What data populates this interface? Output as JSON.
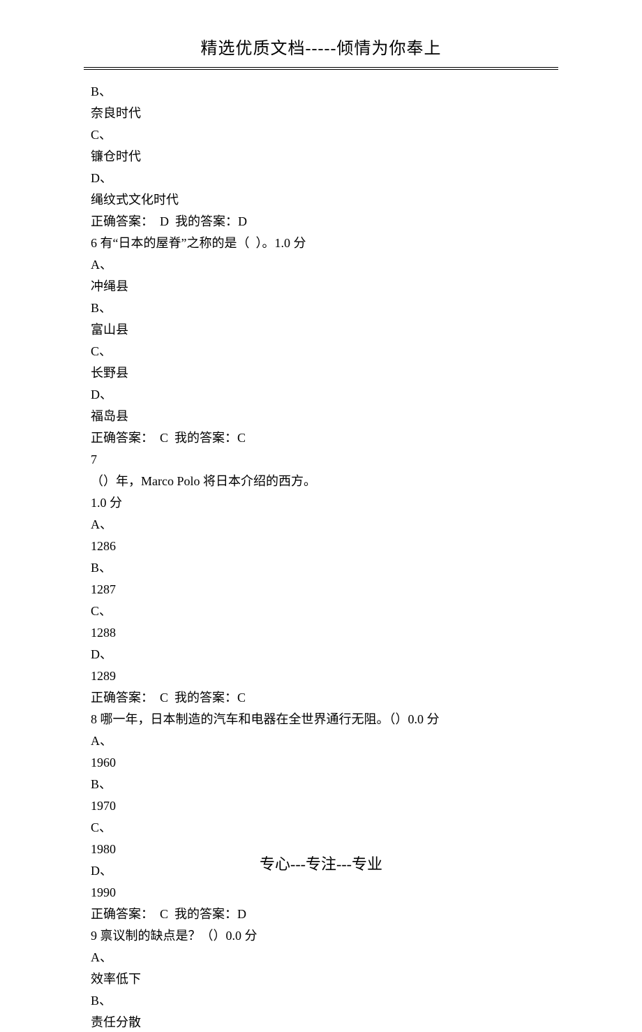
{
  "header": "精选优质文档-----倾情为你奉上",
  "footer": "专心---专注---专业",
  "lines": [
    "B、",
    "奈良时代",
    "C、",
    "镰仓时代",
    "D、",
    "绳纹式文化时代",
    "正确答案：  D  我的答案：D",
    "6 有“日本的屋脊”之称的是（  ）。1.0 分",
    "A、",
    "冲绳县",
    "B、",
    "富山县",
    "C、",
    "长野县",
    "D、",
    "福岛县",
    "正确答案：  C  我的答案：C",
    "7",
    "（）年，Marco Polo 将日本介绍的西方。",
    "1.0 分",
    "A、",
    "1286",
    "B、",
    "1287",
    "C、",
    "1288",
    "D、",
    "1289",
    "正确答案：  C  我的答案：C",
    "8 哪一年，日本制造的汽车和电器在全世界通行无阻。（）0.0 分",
    "A、",
    "1960",
    "B、",
    "1970",
    "C、",
    "1980",
    "D、",
    "1990",
    "正确答案：  C  我的答案：D",
    "9 禀议制的缺点是？（）0.0 分",
    "A、",
    "效率低下",
    "B、",
    "责任分散"
  ]
}
